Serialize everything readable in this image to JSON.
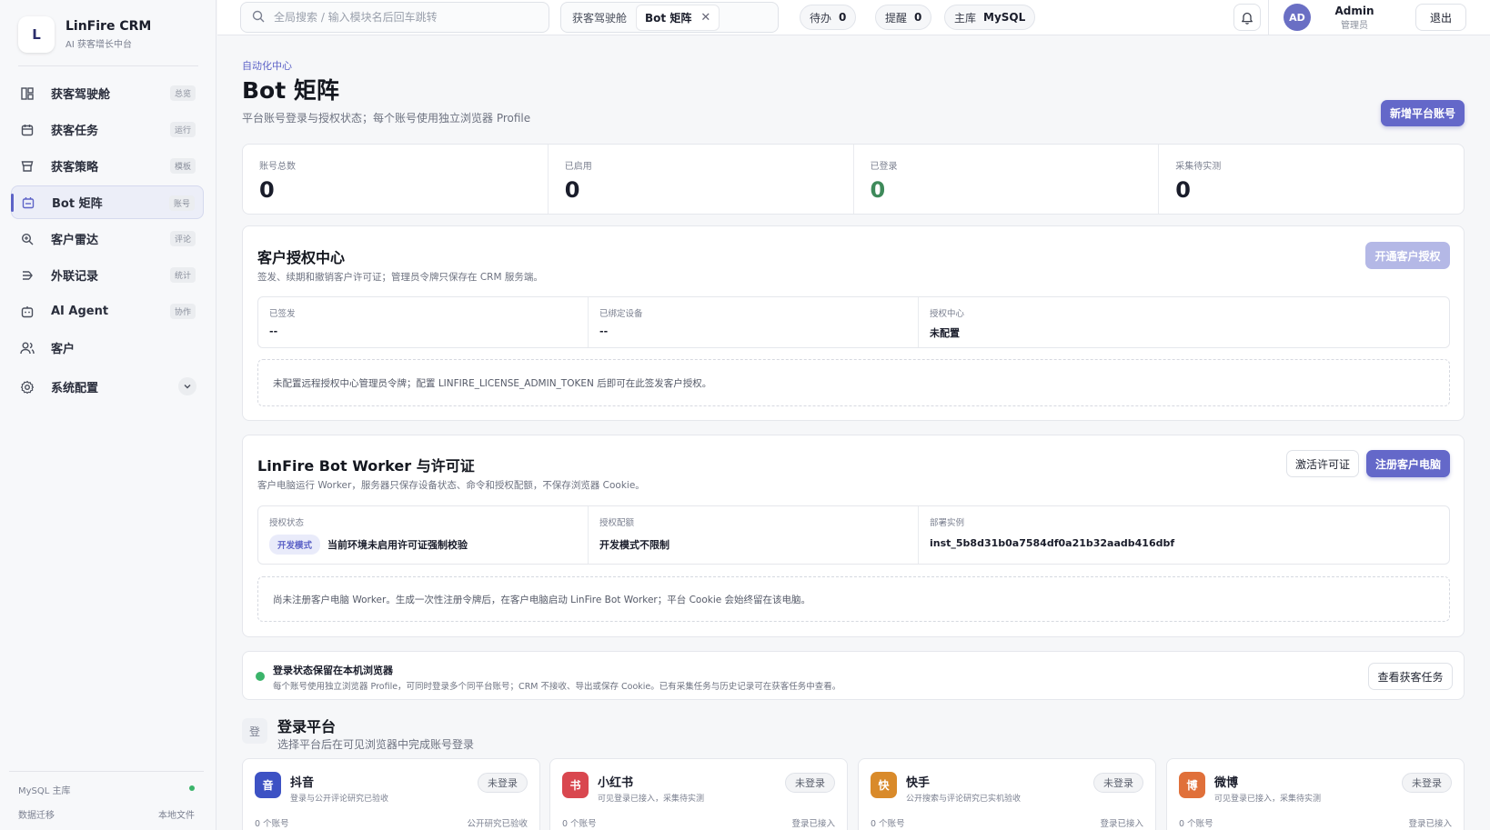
{
  "brand": {
    "logo_text": "L",
    "name": "LinFire CRM",
    "subtitle": "AI 获客增长中台"
  },
  "sidebar": {
    "items": [
      {
        "label": "获客驾驶舱",
        "badge": "总览",
        "icon": "dashboard-icon"
      },
      {
        "label": "获客任务",
        "badge": "运行",
        "icon": "calendar-icon"
      },
      {
        "label": "获客策略",
        "badge": "模板",
        "icon": "store-icon"
      },
      {
        "label": "Bot 矩阵",
        "badge": "账号",
        "icon": "bot-icon",
        "active": true
      },
      {
        "label": "客户雷达",
        "badge": "评论",
        "icon": "radar-search-icon"
      },
      {
        "label": "外联记录",
        "badge": "统计",
        "icon": "outreach-icon"
      },
      {
        "label": "AI Agent",
        "badge": "协作",
        "icon": "agent-icon"
      },
      {
        "label": "客户",
        "badge": "",
        "icon": "users-icon"
      },
      {
        "label": "系统配置",
        "badge": "",
        "icon": "gear-icon"
      }
    ],
    "footer": {
      "db_label": "MySQL 主库",
      "migration_label": "数据迁移",
      "migration_value": "本地文件"
    }
  },
  "topbar": {
    "search_placeholder": "全局搜索 / 输入模块名后回车跳转",
    "tabs": [
      {
        "label": "获客驾驶舱"
      },
      {
        "label": "Bot 矩阵",
        "active": true
      }
    ],
    "pending_label": "待办",
    "pending_value": "0",
    "reminder_label": "提醒",
    "reminder_value": "0",
    "db_label": "主库",
    "db_value": "MySQL",
    "avatar": "AD",
    "user_name": "Admin",
    "user_role": "管理员",
    "logout": "退出"
  },
  "page": {
    "breadcrumb": "自动化中心",
    "title": "Bot 矩阵",
    "subtitle": "平台账号登录与授权状态；每个账号使用独立浏览器 Profile",
    "add_button": "新增平台账号"
  },
  "stats": [
    {
      "label": "账号总数",
      "value": "0"
    },
    {
      "label": "已启用",
      "value": "0"
    },
    {
      "label": "已登录",
      "value": "0"
    },
    {
      "label": "采集待实测",
      "value": "0"
    }
  ],
  "license_center": {
    "title": "客户授权中心",
    "subtitle": "签发、续期和撤销客户许可证；管理员令牌只保存在 CRM 服务端。",
    "button": "开通客户授权",
    "cells": [
      {
        "label": "已签发",
        "value": "--"
      },
      {
        "label": "已绑定设备",
        "value": "--"
      },
      {
        "label": "授权中心",
        "value": "未配置"
      }
    ],
    "notice": "未配置远程授权中心管理员令牌；配置 LINFIRE_LICENSE_ADMIN_TOKEN 后即可在此签发客户授权。"
  },
  "worker": {
    "title": "LinFire Bot Worker 与许可证",
    "subtitle": "客户电脑运行 Worker，服务器只保存设备状态、命令和授权配额，不保存浏览器 Cookie。",
    "activate_button": "激活许可证",
    "register_button": "注册客户电脑",
    "cells": [
      {
        "label": "授权状态",
        "tag": "开发模式",
        "value": "当前环境未启用许可证强制校验"
      },
      {
        "label": "授权配额",
        "value": "开发模式不限制"
      },
      {
        "label": "部署实例",
        "value": "inst_5b8d31b0a7584df0a21b32aadb416dbf"
      }
    ],
    "notice": "尚未注册客户电脑 Worker。生成一次性注册令牌后，在客户电脑启动 LinFire Bot Worker；平台 Cookie 会始终留在该电脑。"
  },
  "banner": {
    "title": "登录状态保留在本机浏览器",
    "text": "每个账号使用独立浏览器 Profile，可同时登录多个同平台账号；CRM 不接收、导出或保存 Cookie。已有采集任务与历史记录可在获客任务中查看。",
    "button": "查看获客任务"
  },
  "platforms": {
    "icon_text": "登",
    "title": "登录平台",
    "subtitle": "选择平台后在可见浏览器中完成账号登录",
    "items": [
      {
        "icon_text": "音",
        "color": "#3d52c4",
        "name": "抖音",
        "desc": "登录与公开评论研究已验收",
        "status": "未登录",
        "count": "0 个账号",
        "note": "公开研究已验收"
      },
      {
        "icon_text": "书",
        "color": "#d9474f",
        "name": "小红书",
        "desc": "可见登录已接入，采集待实测",
        "status": "未登录",
        "count": "0 个账号",
        "note": "登录已接入"
      },
      {
        "icon_text": "快",
        "color": "#d98a2a",
        "name": "快手",
        "desc": "公开搜索与评论研究已实机验收",
        "status": "未登录",
        "count": "0 个账号",
        "note": "登录已接入"
      },
      {
        "icon_text": "博",
        "color": "#e0703a",
        "name": "微博",
        "desc": "可见登录已接入，采集待实测",
        "status": "未登录",
        "count": "0 个账号",
        "note": "登录已接入"
      }
    ]
  },
  "colors": {
    "accent": "#6468c9",
    "success": "#3bb46a",
    "logged_in_value": "#3e8a5a"
  }
}
